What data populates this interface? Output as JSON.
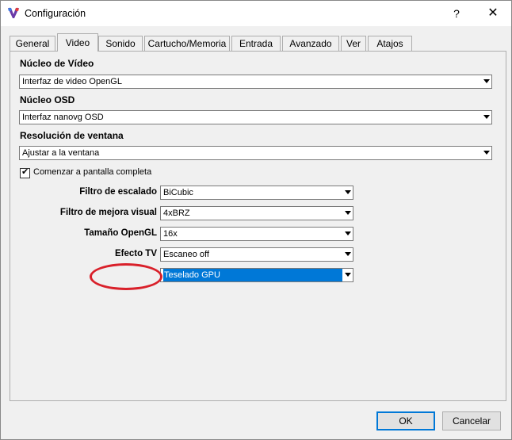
{
  "window": {
    "title": "Configuración",
    "help_label": "?",
    "close_label": "✕"
  },
  "tabs": [
    {
      "label": "General"
    },
    {
      "label": "Video"
    },
    {
      "label": "Sonido"
    },
    {
      "label": "Cartucho/Memoria"
    },
    {
      "label": "Entrada"
    },
    {
      "label": "Avanzado"
    },
    {
      "label": "Ver"
    },
    {
      "label": "Atajos"
    }
  ],
  "active_tab": "Video",
  "video": {
    "core_label": "Núcleo de Vídeo",
    "core_value": "Interfaz de video OpenGL",
    "osd_label": "Núcleo OSD",
    "osd_value": "Interfaz nanovg OSD",
    "resolution_label": "Resolución de ventana",
    "resolution_value": "Ajustar a la ventana",
    "fullscreen_label": "Comenzar a pantalla completa",
    "fullscreen_checked": true,
    "scaling_label": "Filtro de escalado",
    "scaling_value": "BiCubic",
    "enhance_label": "Filtro de mejora visual",
    "enhance_value": "4xBRZ",
    "opengl_size_label": "Tamaño OpenGL",
    "opengl_size_value": "16x",
    "tv_effect_label": "Efecto TV",
    "tv_effect_value": "Escaneo off",
    "unlabeled_value": "Teselado GPU"
  },
  "buttons": {
    "ok": "OK",
    "cancel": "Cancelar"
  },
  "colors": {
    "highlight": "#0078d7",
    "annotation": "#d9202a"
  }
}
